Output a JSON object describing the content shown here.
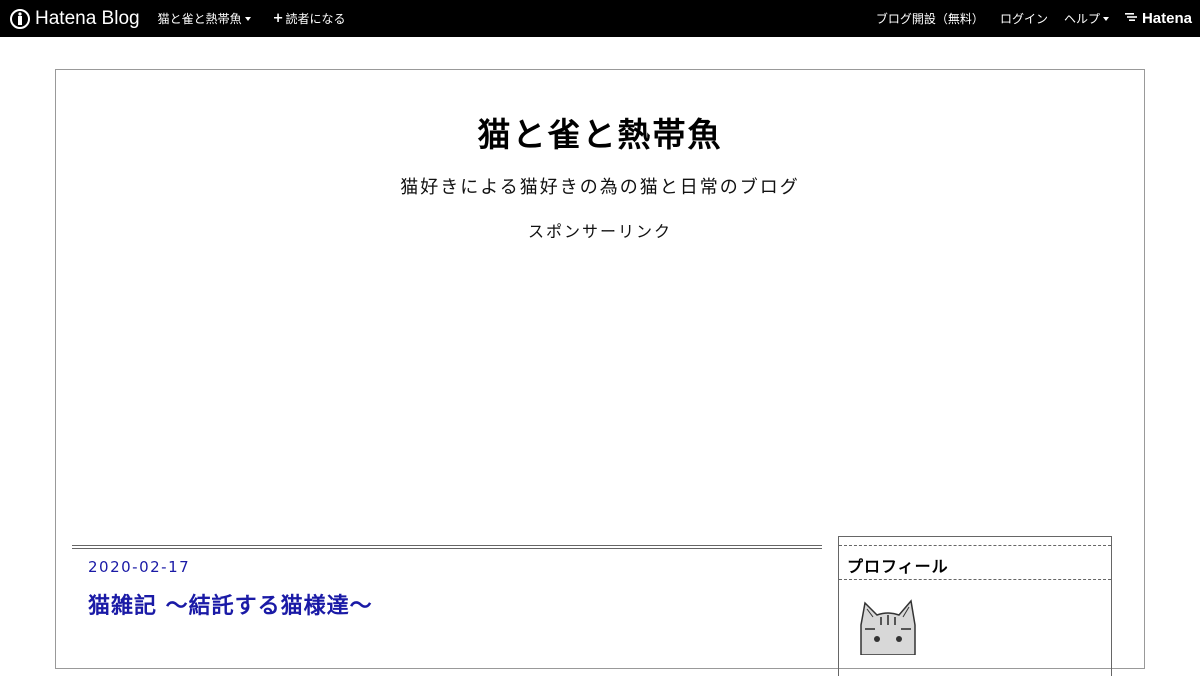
{
  "topbar": {
    "logo_text": "Hatena Blog",
    "blog_menu_label": "猫と雀と熱帯魚",
    "subscribe_label": "読者になる",
    "subscribe_prefix": "+",
    "open_blog_label": "ブログ開設（無料）",
    "login_label": "ログイン",
    "help_label": "ヘルプ",
    "brand_label": "Hatena"
  },
  "blog": {
    "title": "猫と雀と熱帯魚",
    "description": "猫好きによる猫好きの為の猫と日常のブログ",
    "sponsor_label": "スポンサーリンク"
  },
  "article": {
    "date": "2020-02-17",
    "title": "猫雑記 ～結託する猫様達～"
  },
  "sidebar": {
    "profile_title": "プロフィール"
  },
  "colors": {
    "topbar_bg": "#000000",
    "link_blue": "#1a1aa6",
    "frame_border": "#999999"
  },
  "icons": [
    "hatena-blog-logo-icon",
    "caret-down-icon",
    "plus-icon",
    "hatena-brand-icon",
    "cat-avatar-icon"
  ]
}
